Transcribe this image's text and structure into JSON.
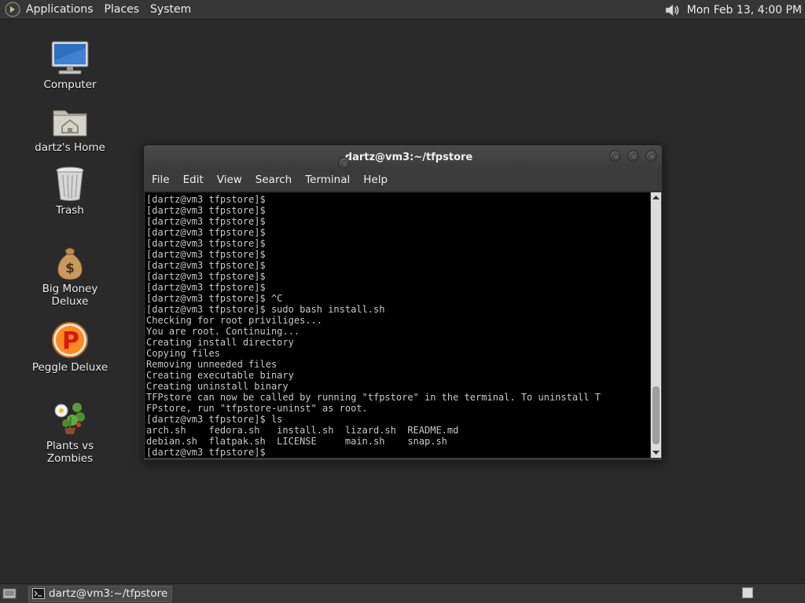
{
  "top_panel": {
    "menus": [
      "Applications",
      "Places",
      "System"
    ],
    "clock": "Mon Feb 13,  4:00 PM",
    "icons": {
      "logo": "gnome-foot-icon",
      "volume": "volume-icon"
    }
  },
  "desktop_icons": [
    {
      "label": "Computer",
      "icon": "computer-icon"
    },
    {
      "label": "dartz's Home",
      "icon": "home-folder-icon"
    },
    {
      "label": "Trash",
      "icon": "trash-icon"
    },
    {
      "label": "Big Money Deluxe",
      "icon": "money-bag-icon"
    },
    {
      "label": "Peggle Deluxe",
      "icon": "peggle-icon"
    },
    {
      "label": "Plants vs Zombies",
      "icon": "plants-vs-zombies-icon"
    }
  ],
  "terminal": {
    "title": "dartz@vm3:~/tfpstore",
    "menu": [
      "File",
      "Edit",
      "View",
      "Search",
      "Terminal",
      "Help"
    ],
    "lines": [
      "[dartz@vm3 tfpstore]$",
      "[dartz@vm3 tfpstore]$",
      "[dartz@vm3 tfpstore]$",
      "[dartz@vm3 tfpstore]$",
      "[dartz@vm3 tfpstore]$",
      "[dartz@vm3 tfpstore]$",
      "[dartz@vm3 tfpstore]$",
      "[dartz@vm3 tfpstore]$",
      "[dartz@vm3 tfpstore]$",
      "[dartz@vm3 tfpstore]$ ^C",
      "[dartz@vm3 tfpstore]$ sudo bash install.sh",
      "Checking for root priviliges...",
      "You are root. Continuing...",
      "Creating install directory",
      "Copying files",
      "Removing unneeded files",
      "Creating executable binary",
      "Creating uninstall binary",
      "TFPstore can now be called by running \"tfpstore\" in the terminal. To uninstall T",
      "FPstore, run \"tfpstore-uninst\" as root.",
      "[dartz@vm3 tfpstore]$ ls",
      "arch.sh    fedora.sh   install.sh  lizard.sh  README.md",
      "debian.sh  flatpak.sh  LICENSE     main.sh    snap.sh",
      "[dartz@vm3 tfpstore]$"
    ],
    "colors": {
      "background": "#000000",
      "foreground": "#c8c8c8"
    }
  },
  "bottom_panel": {
    "task_label": "dartz@vm3:~/tfpstore"
  }
}
